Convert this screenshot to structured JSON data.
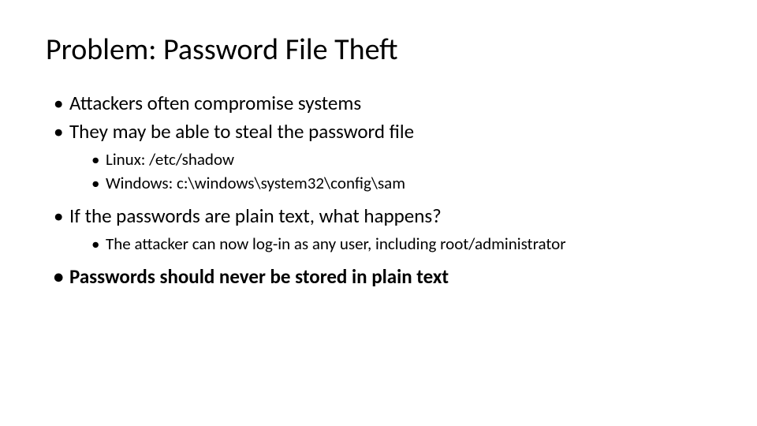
{
  "title": "Problem: Password File Theft",
  "bullets": {
    "b1": "Attackers often compromise systems",
    "b2": "They may be able to steal the password file",
    "b2a": "Linux: /etc/shadow",
    "b2b": "Windows: c:\\windows\\system32\\config\\sam",
    "b3": "If the passwords are plain text, what happens?",
    "b3a": "The attacker can now log-in as any user, including root/administrator",
    "b4": "Passwords should never be stored in plain text"
  }
}
